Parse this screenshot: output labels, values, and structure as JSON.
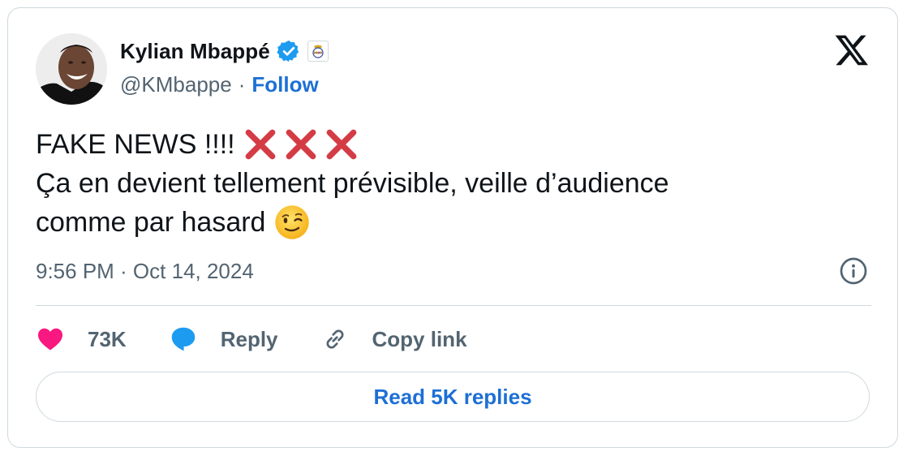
{
  "author": {
    "display_name": "Kylian Mbappé",
    "handle": "@KMbappe",
    "separator": "·",
    "follow_label": "Follow",
    "verified_badge_icon": "verified-badge-icon",
    "affiliate_badge_icon": "real-madrid-crest-icon",
    "avatar_icon": "profile-photo"
  },
  "tweet": {
    "line1": "FAKE NEWS !!!!",
    "line1_emoji": [
      "cross-mark",
      "cross-mark",
      "cross-mark"
    ],
    "line2": "Ça en devient tellement prévisible, veille d’audience",
    "line3": "comme par hasard",
    "line3_emoji": "winking-face"
  },
  "meta": {
    "timestamp": "9:56 PM · Oct 14, 2024"
  },
  "actions": {
    "likes_count": "73K",
    "reply_label": "Reply",
    "copy_link_label": "Copy link"
  },
  "read_replies_label": "Read 5K replies",
  "colors": {
    "link_blue": "#1d6fd6",
    "verified_blue": "#1d9bf0",
    "like_pink": "#f91880",
    "secondary_text": "#536471",
    "border": "#cfd9de",
    "cross_red": "#d43c45"
  }
}
